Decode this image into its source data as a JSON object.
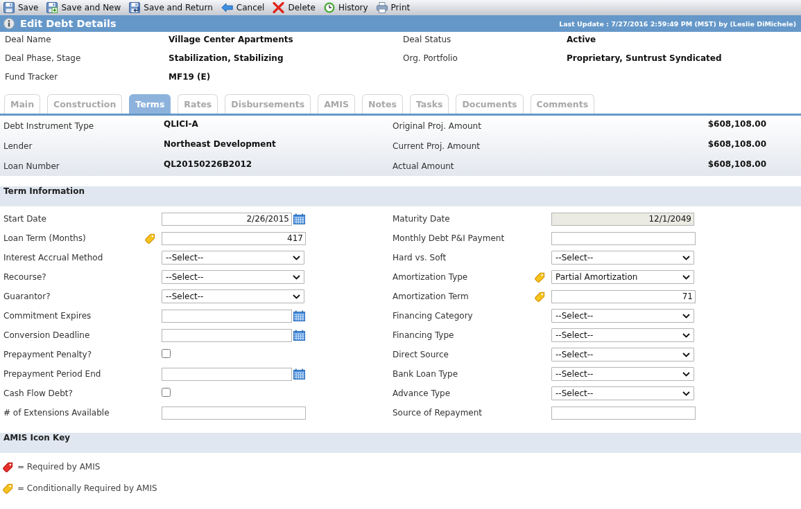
{
  "toolbar": [
    {
      "kind": "save",
      "label": "Save"
    },
    {
      "kind": "save_new",
      "label": "Save and New"
    },
    {
      "kind": "save_return",
      "label": "Save and Return"
    },
    {
      "kind": "cancel",
      "label": "Cancel"
    },
    {
      "kind": "delete",
      "label": "Delete"
    },
    {
      "kind": "history",
      "label": "History"
    },
    {
      "kind": "print",
      "label": "Print"
    }
  ],
  "header": {
    "title": "Edit Debt Details",
    "last_update": "Last Update : 7/27/2016 2:59:49 PM (MST) by (Leslie DiMichele)"
  },
  "deal_info": [
    {
      "left": {
        "label": "Deal Name",
        "value": "Village Center Apartments"
      },
      "right": {
        "label": "Deal Status",
        "value": "Active"
      }
    },
    {
      "left": {
        "label": "Deal Phase, Stage",
        "value": "Stabilization, Stabilizing"
      },
      "right": {
        "label": "Org. Portfolio",
        "value": "Proprietary, Suntrust Syndicated"
      }
    },
    {
      "left": {
        "label": "Fund Tracker",
        "value": "MF19 (E)"
      }
    }
  ],
  "tabs": [
    {
      "label": "Main",
      "selected": false
    },
    {
      "label": "Construction",
      "selected": false
    },
    {
      "label": "Terms",
      "selected": true
    },
    {
      "label": "Rates",
      "selected": false
    },
    {
      "label": "Disbursements",
      "selected": false
    },
    {
      "label": "AMIS",
      "selected": false
    },
    {
      "label": "Notes",
      "selected": false
    },
    {
      "label": "Tasks",
      "selected": false
    },
    {
      "label": "Documents",
      "selected": false
    },
    {
      "label": "Comments",
      "selected": false
    }
  ],
  "debt_summary": [
    {
      "left": {
        "label": "Debt Instrument Type",
        "value": "QLICI-A"
      },
      "right": {
        "label": "Original Proj. Amount",
        "value": "$608,108.00"
      }
    },
    {
      "left": {
        "label": "Lender",
        "value": "Northeast Development"
      },
      "right": {
        "label": "Current Proj. Amount",
        "value": "$608,108.00"
      }
    },
    {
      "left": {
        "label": "Loan Number",
        "value": "QL20150226B2012"
      },
      "right": {
        "label": "Actual Amount",
        "value": "$608,108.00"
      }
    }
  ],
  "term_information": {
    "title": "Term Information",
    "rows": [
      {
        "left": {
          "label": "Start Date",
          "kind": "date",
          "value": "2/26/2015",
          "conditionally_required": false
        },
        "right": {
          "label": "Maturity Date",
          "kind": "readonly",
          "value": "12/1/2049",
          "conditionally_required": false
        }
      },
      {
        "left": {
          "label": "Loan Term (Months)",
          "kind": "text",
          "value": "417",
          "conditionally_required": true
        },
        "right": {
          "label": "Monthly Debt P&I Payment",
          "kind": "text",
          "conditionally_required": false
        }
      },
      {
        "left": {
          "label": "Interest Accrual Method",
          "kind": "select",
          "value": "--Select--",
          "conditionally_required": false
        },
        "right": {
          "label": "Hard vs. Soft",
          "kind": "select",
          "value": "--Select--",
          "conditionally_required": false
        }
      },
      {
        "left": {
          "label": "Recourse?",
          "kind": "select",
          "value": "--Select--",
          "conditionally_required": false
        },
        "right": {
          "label": "Amortization Type",
          "kind": "select",
          "value": "Partial Amortization",
          "conditionally_required": true
        }
      },
      {
        "left": {
          "label": "Guarantor?",
          "kind": "select",
          "value": "--Select--",
          "conditionally_required": false
        },
        "right": {
          "label": "Amortization Term",
          "kind": "text",
          "value": "71",
          "conditionally_required": true
        }
      },
      {
        "left": {
          "label": "Commitment Expires",
          "kind": "date",
          "conditionally_required": false
        },
        "right": {
          "label": "Financing Category",
          "kind": "select",
          "value": "--Select--",
          "conditionally_required": false
        }
      },
      {
        "left": {
          "label": "Conversion Deadline",
          "kind": "date",
          "conditionally_required": false
        },
        "right": {
          "label": "Financing Type",
          "kind": "select",
          "value": "--Select--",
          "conditionally_required": false
        }
      },
      {
        "left": {
          "label": "Prepayment Penalty?",
          "kind": "checkbox",
          "checked": false,
          "conditionally_required": false
        },
        "right": {
          "label": "Direct Source",
          "kind": "select",
          "value": "--Select--",
          "conditionally_required": false
        }
      },
      {
        "left": {
          "label": "Prepayment Period End",
          "kind": "date",
          "conditionally_required": false
        },
        "right": {
          "label": "Bank Loan Type",
          "kind": "select",
          "value": "--Select--",
          "conditionally_required": false
        }
      },
      {
        "left": {
          "label": "Cash Flow Debt?",
          "kind": "checkbox",
          "checked": false,
          "conditionally_required": false
        },
        "right": {
          "label": "Advance Type",
          "kind": "select",
          "value": "--Select--",
          "conditionally_required": false
        }
      },
      {
        "left": {
          "label": "# of Extensions Available",
          "kind": "text",
          "conditionally_required": false
        },
        "right": {
          "label": "Source of Repayment",
          "kind": "text",
          "conditionally_required": false
        }
      }
    ]
  },
  "amis_icon_key": {
    "title": "AMIS Icon Key",
    "items": [
      {
        "kind": "required",
        "text": "= Required by AMIS"
      },
      {
        "kind": "conditional",
        "text": "= Conditionally Required by AMIS"
      }
    ]
  }
}
